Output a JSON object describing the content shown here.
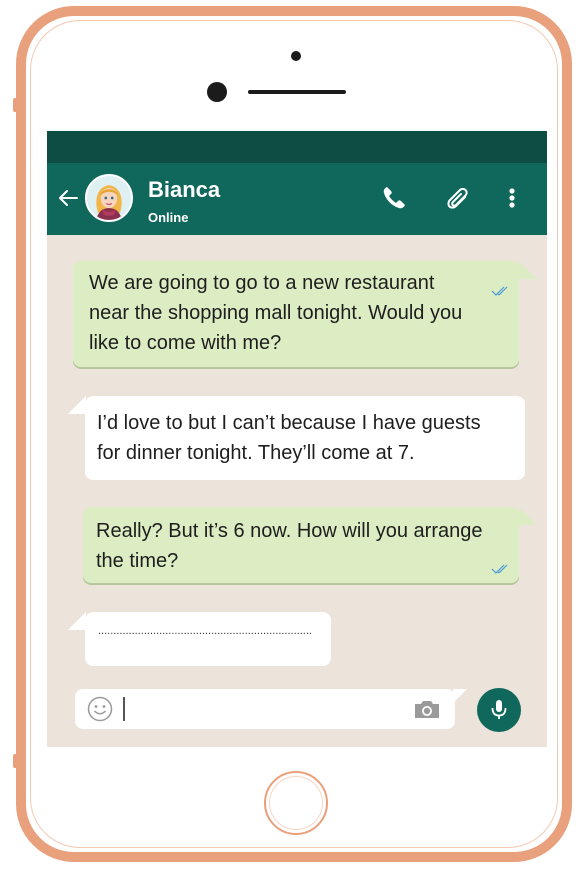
{
  "contact": {
    "name": "Bianca",
    "status": "Online"
  },
  "header": {
    "icons": [
      "back-arrow-icon",
      "phone-icon",
      "paperclip-icon",
      "more-vertical-icon"
    ]
  },
  "messages": [
    {
      "direction": "outgoing",
      "text_lines": [
        "We are going to go to a new restaurant",
        "near the shopping mall tonight. Would you",
        "like to come with me?"
      ],
      "read_ticks": true
    },
    {
      "direction": "incoming",
      "text_lines": [
        "I’d love to but I can’t because I have guests",
        "for dinner tonight. They’ll come at 7."
      ]
    },
    {
      "direction": "outgoing",
      "text_lines": [
        "Really? But it’s 6 now. How will you arrange",
        "the time?"
      ],
      "read_ticks": true
    },
    {
      "direction": "incoming",
      "text_lines": [
        "......................................................................"
      ]
    }
  ],
  "composer": {
    "input_value": "",
    "icons": [
      "emoji-icon",
      "camera-icon",
      "microphone-icon"
    ]
  },
  "colors": {
    "header": "#10675b",
    "status_bar": "#0d4d44",
    "chat_background": "#ece4da",
    "outgoing_bubble": "#dcecc3",
    "incoming_bubble": "#ffffff",
    "phone_frame": "#e9a07c",
    "tick_color": "#4a9ad8"
  }
}
